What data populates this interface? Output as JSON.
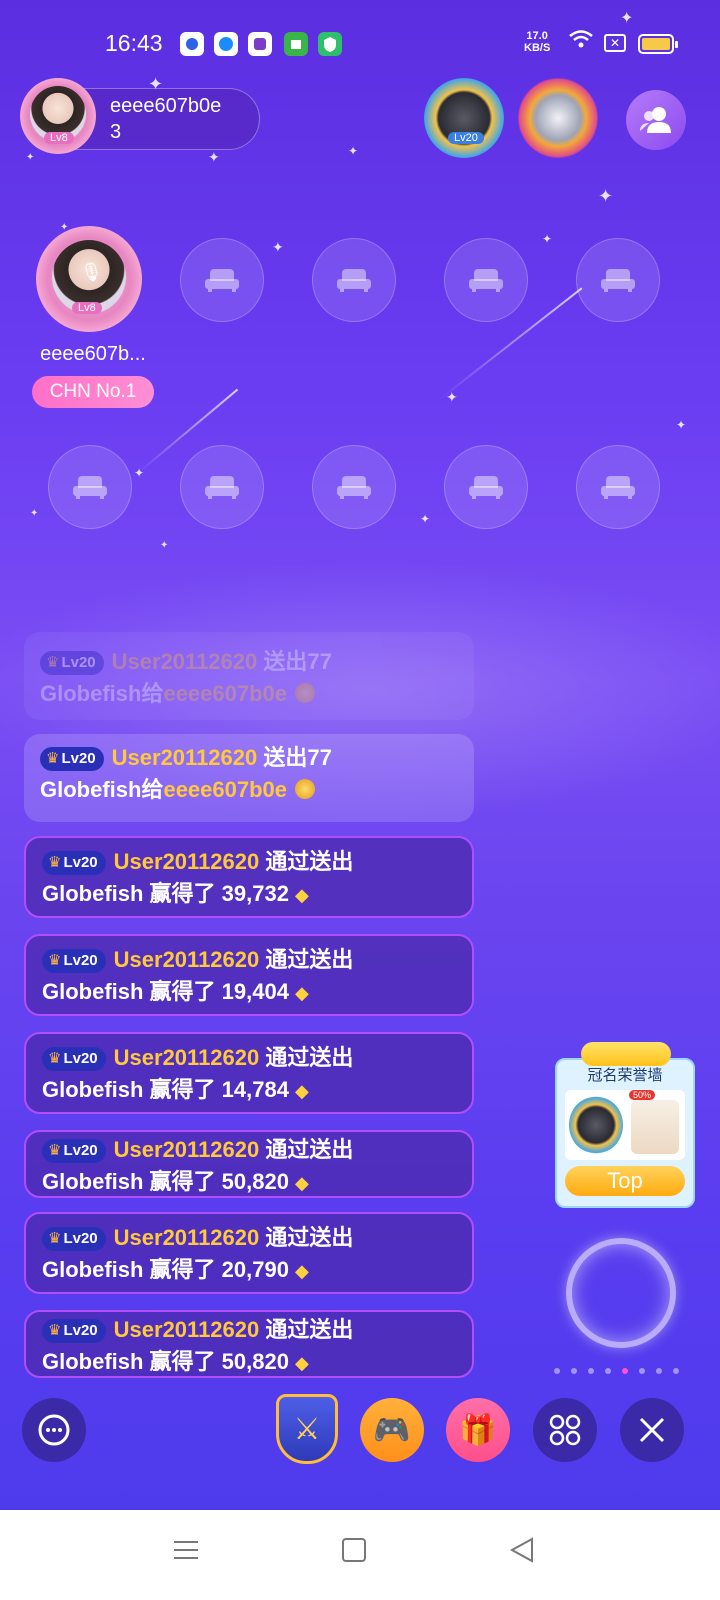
{
  "status_bar": {
    "time": "16:43",
    "net_speed_value": "17.0",
    "net_speed_unit": "KB/S",
    "battery_level": 1.0
  },
  "room": {
    "host_name": "eeee607b0e",
    "host_count": "3",
    "host_level": "Lv8",
    "rank_badge_level": "Lv20"
  },
  "seats": {
    "host_seat_name": "eeee607b...",
    "host_seat_level": "Lv8",
    "host_badge": "CHN No.1"
  },
  "chat": [
    {
      "level": "Lv20",
      "user": "User20112620",
      "action": "送出77",
      "line2_prefix": "Globefish给",
      "line2_target": "eeee607b0e",
      "kind": "gift"
    },
    {
      "level": "Lv20",
      "user": "User20112620",
      "action": "送出77",
      "line2_prefix": "Globefish给",
      "line2_target": "eeee607b0e",
      "kind": "gift"
    },
    {
      "level": "Lv20",
      "user": "User20112620",
      "action": "通过送出",
      "line2": "Globefish 赢得了 39,732",
      "kind": "win"
    },
    {
      "level": "Lv20",
      "user": "User20112620",
      "action": "通过送出",
      "line2": "Globefish 赢得了 19,404",
      "kind": "win"
    },
    {
      "level": "Lv20",
      "user": "User20112620",
      "action": "通过送出",
      "line2": "Globefish 赢得了 14,784",
      "kind": "win"
    },
    {
      "level": "Lv20",
      "user": "User20112620",
      "action": "通过送出",
      "line2": "Globefish 赢得了 50,820",
      "kind": "win"
    },
    {
      "level": "Lv20",
      "user": "User20112620",
      "action": "通过送出",
      "line2": "Globefish 赢得了 20,790",
      "kind": "win"
    },
    {
      "level": "Lv20",
      "user": "User20112620",
      "action": "通过送出",
      "line2": "Globefish 赢得了 50,820",
      "kind": "win"
    }
  ],
  "honor_wall": {
    "title": "冠名荣誉墙",
    "button": "Top",
    "discount": "50%"
  },
  "carousel": {
    "dots": 8,
    "active": 4
  },
  "colors": {
    "accent_pink": "#ff6fc8",
    "gold": "#ffc83d",
    "win_border": "#b24cff"
  }
}
